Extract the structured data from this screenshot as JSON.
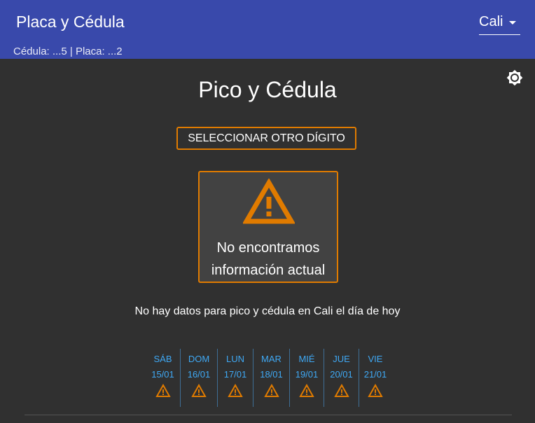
{
  "header": {
    "title": "Placa y Cédula",
    "subtitle": "Cédula: ...5 | Placa: ...2",
    "city": "Cali",
    "bg_color": "#3949ab"
  },
  "theme_toggle": {
    "icon": "brightness-icon"
  },
  "main": {
    "title": "Pico y Cédula",
    "select_button": "SELECCIONAR OTRO DÍGITO",
    "warning_card": {
      "icon": "warning-icon",
      "line1": "No encontramos",
      "line2": "información actual"
    },
    "no_data_message": "No hay datos para pico y cédula en Cali el día de hoy",
    "accent_color": "#e07b00",
    "link_color": "#3fa9f5"
  },
  "days": [
    {
      "name": "SÁB",
      "date": "15/01",
      "icon": "warning-icon"
    },
    {
      "name": "DOM",
      "date": "16/01",
      "icon": "warning-icon"
    },
    {
      "name": "LUN",
      "date": "17/01",
      "icon": "warning-icon"
    },
    {
      "name": "MAR",
      "date": "18/01",
      "icon": "warning-icon"
    },
    {
      "name": "MIÉ",
      "date": "19/01",
      "icon": "warning-icon"
    },
    {
      "name": "JUE",
      "date": "20/01",
      "icon": "warning-icon"
    },
    {
      "name": "VIE",
      "date": "21/01",
      "icon": "warning-icon"
    }
  ]
}
